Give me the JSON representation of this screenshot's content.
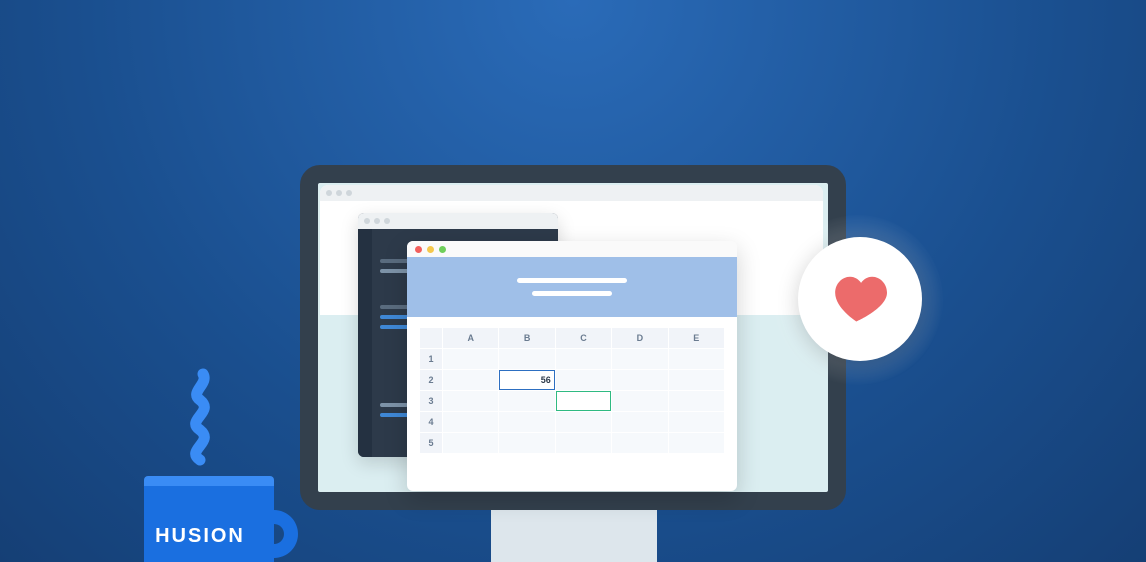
{
  "spreadsheet": {
    "columns": [
      "A",
      "B",
      "C",
      "D",
      "E"
    ],
    "rows": [
      "1",
      "2",
      "3",
      "4",
      "5"
    ],
    "selected_cell_value": "56"
  },
  "mug": {
    "text": "HUSION"
  }
}
